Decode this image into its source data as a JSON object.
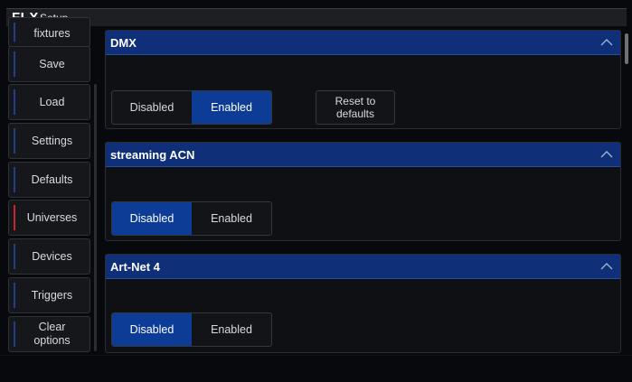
{
  "app": {
    "logo": "FLX",
    "title": "Setup"
  },
  "sidebar": {
    "items": [
      {
        "label": "fixtures",
        "active": false
      },
      {
        "label": "Save",
        "active": false
      },
      {
        "label": "Load",
        "active": false
      },
      {
        "label": "Settings",
        "active": false
      },
      {
        "label": "Defaults",
        "active": false
      },
      {
        "label": "Universes",
        "active": true
      },
      {
        "label": "Devices",
        "active": false
      },
      {
        "label": "Triggers",
        "active": false
      },
      {
        "label": "Clear options",
        "active": false
      }
    ]
  },
  "panels": [
    {
      "title": "DMX",
      "disabled_label": "Disabled",
      "enabled_label": "Enabled",
      "selected": "Enabled",
      "reset_label": "Reset to defaults"
    },
    {
      "title": "streaming ACN",
      "disabled_label": "Disabled",
      "enabled_label": "Enabled",
      "selected": "Disabled"
    },
    {
      "title": "Art-Net 4",
      "disabled_label": "Disabled",
      "enabled_label": "Enabled",
      "selected": "Disabled"
    }
  ],
  "icons": {
    "collapse": "chevron-up-icon"
  },
  "colors": {
    "accent": "#0d3c96",
    "header": "#0f2f78",
    "active_marker": "#c8282b"
  }
}
